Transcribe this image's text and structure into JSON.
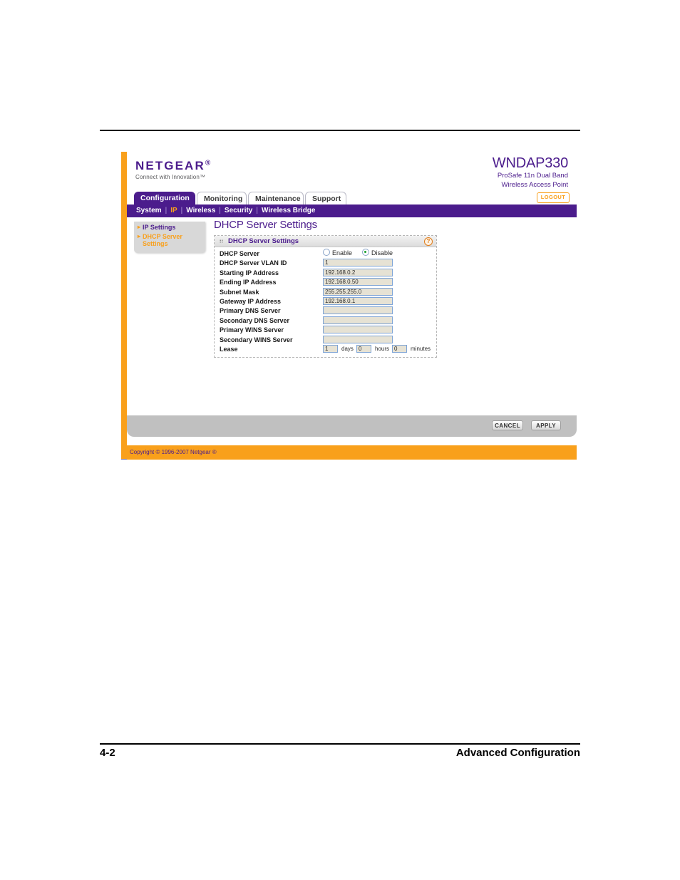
{
  "manual": {
    "folio_left": "4-2",
    "folio_right": "Advanced Configuration"
  },
  "device_ui": {
    "brand": {
      "name": "NETGEAR",
      "registered_mark": "®",
      "tagline": "Connect with Innovation™"
    },
    "model": {
      "name": "WNDAP330",
      "line1": "ProSafe 11n Dual Band",
      "line2": "Wireless Access Point"
    },
    "logout_label": "LOGOUT",
    "tabs": [
      {
        "label": "Configuration",
        "active": true
      },
      {
        "label": "Monitoring",
        "active": false
      },
      {
        "label": "Maintenance",
        "active": false
      },
      {
        "label": "Support",
        "active": false
      }
    ],
    "subnav": [
      {
        "label": "System",
        "selected": false
      },
      {
        "label": "IP",
        "selected": true
      },
      {
        "label": "Wireless",
        "selected": false
      },
      {
        "label": "Security",
        "selected": false
      },
      {
        "label": "Wireless Bridge",
        "selected": false
      }
    ],
    "sidebar": {
      "items": [
        {
          "label": "IP Settings",
          "selected": false
        },
        {
          "label": "DHCP Server Settings",
          "selected": true
        }
      ]
    },
    "page_title": "DHCP Server Settings",
    "panel": {
      "title": "DHCP Server Settings",
      "help_glyph": "?",
      "rows": [
        {
          "label": "DHCP Server",
          "type": "radio",
          "options": [
            {
              "label": "Enable",
              "selected": false
            },
            {
              "label": "Disable",
              "selected": true
            }
          ]
        },
        {
          "label": "DHCP Server VLAN ID",
          "type": "text",
          "value": "1"
        },
        {
          "label": "Starting IP Address",
          "type": "text",
          "value": "192.168.0.2"
        },
        {
          "label": "Ending IP Address",
          "type": "text",
          "value": "192.168.0.50"
        },
        {
          "label": "Subnet Mask",
          "type": "text",
          "value": "255.255.255.0"
        },
        {
          "label": "Gateway IP Address",
          "type": "text",
          "value": "192.168.0.1"
        },
        {
          "label": "Primary DNS Server",
          "type": "text",
          "value": ""
        },
        {
          "label": "Secondary DNS Server",
          "type": "text",
          "value": ""
        },
        {
          "label": "Primary WINS Server",
          "type": "text",
          "value": ""
        },
        {
          "label": "Secondary WINS Server",
          "type": "text",
          "value": ""
        }
      ],
      "lease": {
        "label": "Lease",
        "days": {
          "value": "1",
          "unit": "days"
        },
        "hours": {
          "value": "0",
          "unit": "hours"
        },
        "minutes": {
          "value": "0",
          "unit": "minutes"
        }
      }
    },
    "actions": {
      "cancel_label": "CANCEL",
      "apply_label": "APPLY"
    },
    "copyright": "Copyright © 1996-2007 Netgear ®",
    "colors": {
      "brand_purple": "#4b1c8c",
      "accent_orange": "#f9a01b",
      "radio_on_green": "#17a02c",
      "field_fill": "#e6e2d4",
      "field_border": "#7ea4d6"
    }
  }
}
